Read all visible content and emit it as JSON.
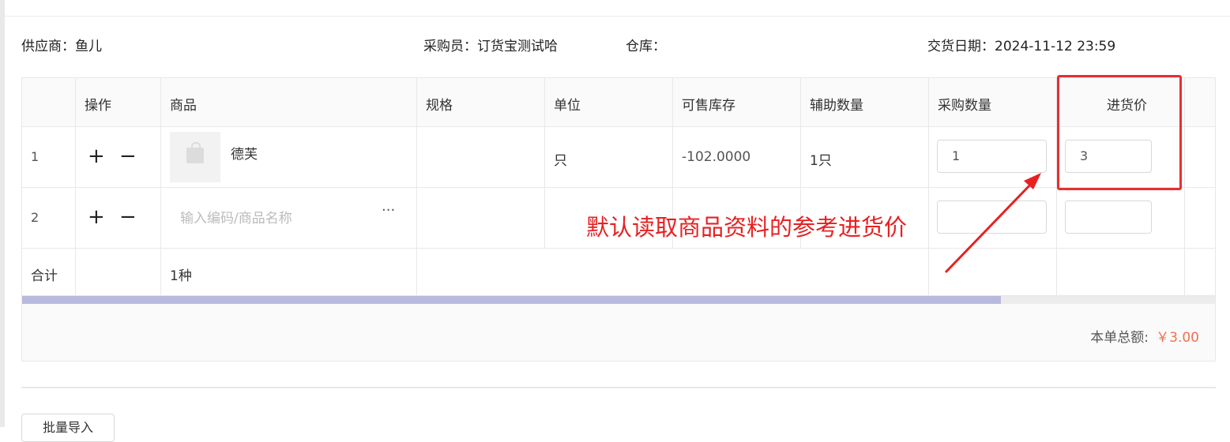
{
  "header": {
    "supplier": "供应商：鱼儿",
    "buyer": "采购员：订货宝测试哈",
    "warehouse": "仓库：",
    "delivery_date": "交货日期：2024-11-12 23:59"
  },
  "table": {
    "columns": [
      "",
      "操作",
      "商品",
      "规格",
      "单位",
      "可售库存",
      "辅助数量",
      "采购数量",
      "进货价"
    ],
    "rows": [
      {
        "index": "1",
        "product": "德芙",
        "spec": "",
        "unit": "只",
        "stock": "-102.0000",
        "aux_qty": "1只",
        "purchase_qty": "1",
        "price": "3"
      },
      {
        "index": "2",
        "product_placeholder": "输入编码/商品名称",
        "more": "···",
        "purchase_qty": "",
        "price": ""
      }
    ],
    "total": {
      "label": "合计",
      "count": "1种"
    },
    "op_add": "+",
    "op_remove": "−"
  },
  "summary": {
    "label": "本单总额:",
    "value": "￥3.00"
  },
  "annotation": {
    "text": "默认读取商品资料的参考进货价",
    "color": "#e82020"
  },
  "buttons": {
    "batch_import": "批量导入"
  },
  "scroll": {
    "position_fraction": 0.82
  }
}
